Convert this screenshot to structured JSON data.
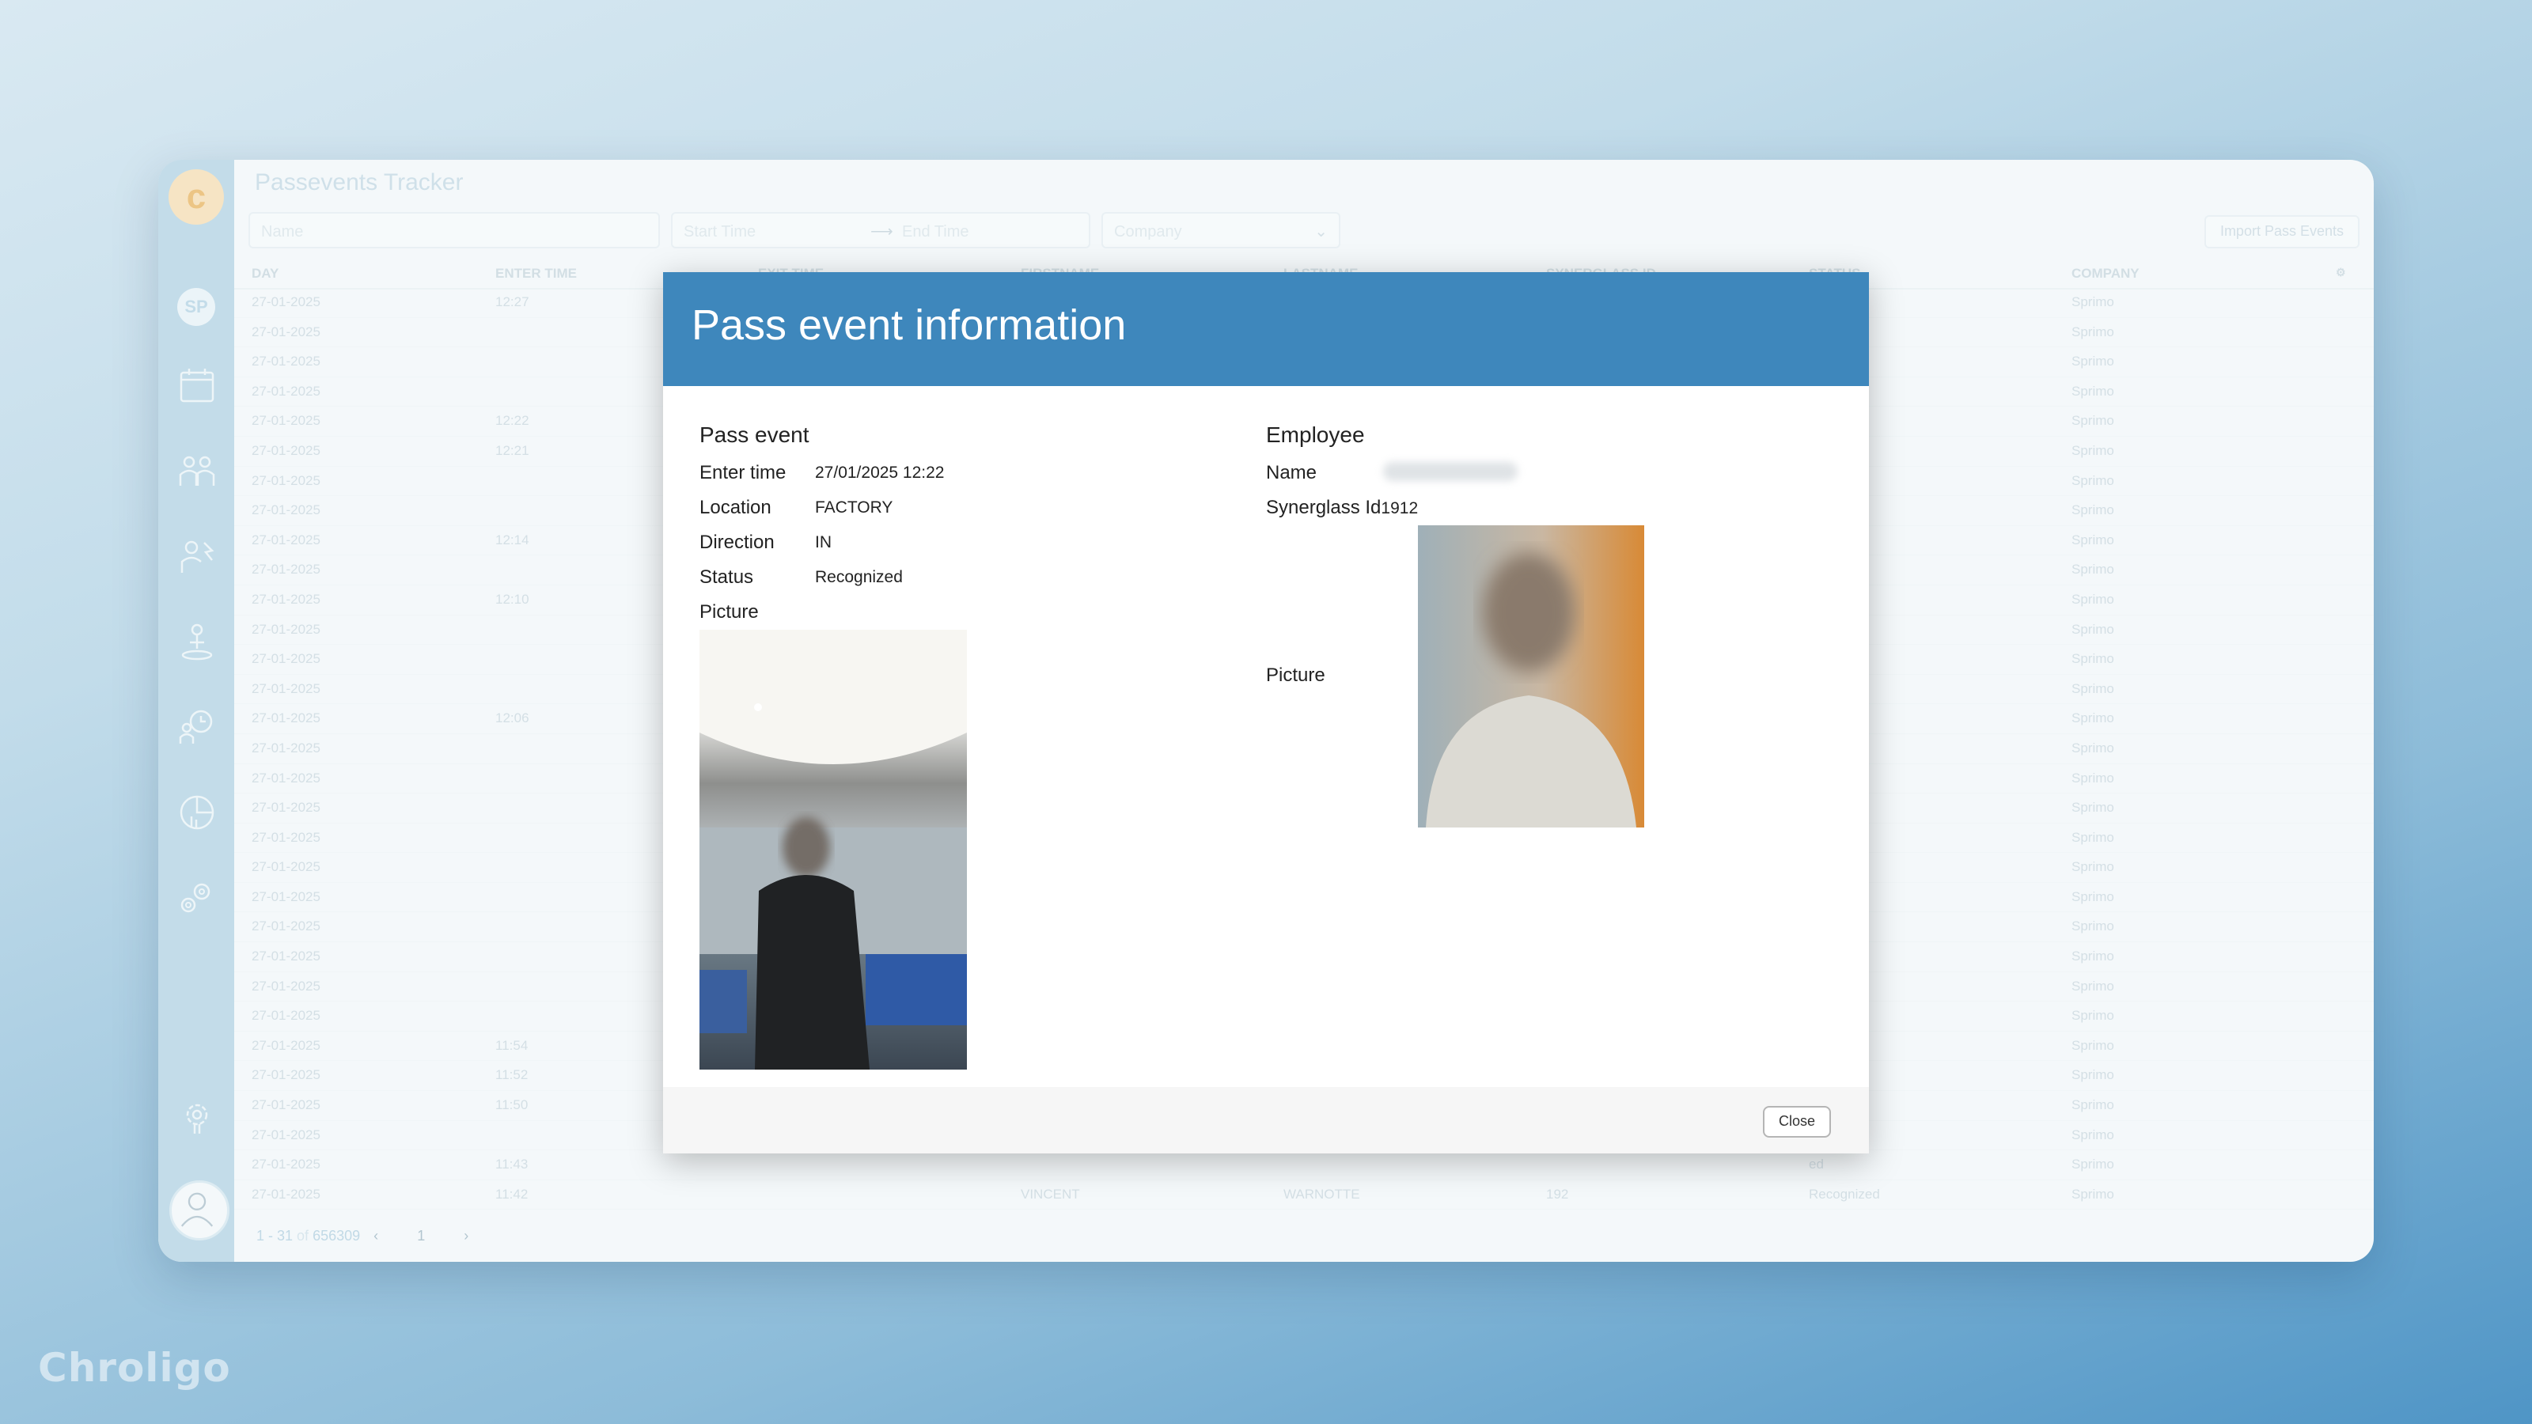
{
  "brand": "Chroligo",
  "app": {
    "logo_letter": "c",
    "user_initials": "SP",
    "page_title": "Passevents Tracker",
    "filters": {
      "name_placeholder": "Name",
      "start_time_placeholder": "Start Time",
      "end_time_placeholder": "End Time",
      "company_placeholder": "Company"
    },
    "import_button": "Import Pass Events",
    "columns": [
      "DAY",
      "ENTER TIME",
      "EXIT TIME",
      "FIRSTNAME",
      "LASTNAME",
      "SYNERGLASS ID",
      "STATUS",
      "COMPANY"
    ],
    "rows": [
      {
        "day": "27-01-2025",
        "enter": "12:27",
        "status": "ed",
        "company": "Sprimo"
      },
      {
        "day": "27-01-2025",
        "enter": "",
        "status": "ed",
        "company": "Sprimo"
      },
      {
        "day": "27-01-2025",
        "enter": "",
        "status": "ed",
        "company": "Sprimo"
      },
      {
        "day": "27-01-2025",
        "enter": "",
        "status": "ed",
        "company": "Sprimo"
      },
      {
        "day": "27-01-2025",
        "enter": "12:22",
        "status": "ed",
        "company": "Sprimo"
      },
      {
        "day": "27-01-2025",
        "enter": "12:21",
        "status": "ed",
        "company": "Sprimo"
      },
      {
        "day": "27-01-2025",
        "enter": "",
        "status": "ed",
        "company": "Sprimo"
      },
      {
        "day": "27-01-2025",
        "enter": "",
        "status": "ed",
        "company": "Sprimo"
      },
      {
        "day": "27-01-2025",
        "enter": "12:14",
        "status": "ed",
        "company": "Sprimo"
      },
      {
        "day": "27-01-2025",
        "enter": "",
        "status": "ed",
        "company": "Sprimo"
      },
      {
        "day": "27-01-2025",
        "enter": "12:10",
        "status": "ed",
        "company": "Sprimo"
      },
      {
        "day": "27-01-2025",
        "enter": "",
        "status": "ed",
        "company": "Sprimo"
      },
      {
        "day": "27-01-2025",
        "enter": "",
        "status": "ed",
        "company": "Sprimo"
      },
      {
        "day": "27-01-2025",
        "enter": "",
        "status": "ed",
        "company": "Sprimo"
      },
      {
        "day": "27-01-2025",
        "enter": "12:06",
        "status": "ed",
        "company": "Sprimo"
      },
      {
        "day": "27-01-2025",
        "enter": "",
        "status": "ed",
        "company": "Sprimo"
      },
      {
        "day": "27-01-2025",
        "enter": "",
        "status": "ed",
        "company": "Sprimo"
      },
      {
        "day": "27-01-2025",
        "enter": "",
        "status": "lled",
        "company": "Sprimo"
      },
      {
        "day": "27-01-2025",
        "enter": "",
        "status": "lled",
        "company": "Sprimo"
      },
      {
        "day": "27-01-2025",
        "enter": "",
        "status": "ed",
        "company": "Sprimo"
      },
      {
        "day": "27-01-2025",
        "enter": "",
        "status": "ed",
        "company": "Sprimo"
      },
      {
        "day": "27-01-2025",
        "enter": "",
        "status": "ed",
        "company": "Sprimo"
      },
      {
        "day": "27-01-2025",
        "enter": "",
        "status": "ed",
        "company": "Sprimo"
      },
      {
        "day": "27-01-2025",
        "enter": "",
        "status": "ed",
        "company": "Sprimo"
      },
      {
        "day": "27-01-2025",
        "enter": "",
        "status": "ed",
        "company": "Sprimo"
      },
      {
        "day": "27-01-2025",
        "enter": "11:54",
        "status": "ed",
        "company": "Sprimo"
      },
      {
        "day": "27-01-2025",
        "enter": "11:52",
        "status": "ed",
        "company": "Sprimo"
      },
      {
        "day": "27-01-2025",
        "enter": "11:50",
        "status": "ed",
        "company": "Sprimo"
      },
      {
        "day": "27-01-2025",
        "enter": "",
        "status": "ed",
        "company": "Sprimo"
      },
      {
        "day": "27-01-2025",
        "enter": "11:43",
        "status": "ed",
        "company": "Sprimo"
      },
      {
        "day": "27-01-2025",
        "enter": "11:42",
        "firstname": "VINCENT",
        "lastname": "WARNOTTE",
        "synerglass": "192",
        "status": "Recognized",
        "company": "Sprimo"
      }
    ],
    "pager": {
      "range": "1 - 31",
      "of": "of",
      "total": "656309",
      "page": "1"
    }
  },
  "modal": {
    "title": "Pass event information",
    "pass_event": {
      "heading": "Pass event",
      "enter_time_label": "Enter time",
      "enter_time": "27/01/2025 12:22",
      "location_label": "Location",
      "location": "FACTORY",
      "direction_label": "Direction",
      "direction": "IN",
      "status_label": "Status",
      "status": "Recognized",
      "picture_label": "Picture"
    },
    "employee": {
      "heading": "Employee",
      "name_label": "Name",
      "synerglass_label": "Synerglass Id",
      "synerglass_id": "1912",
      "picture_label": "Picture"
    },
    "close_label": "Close"
  }
}
